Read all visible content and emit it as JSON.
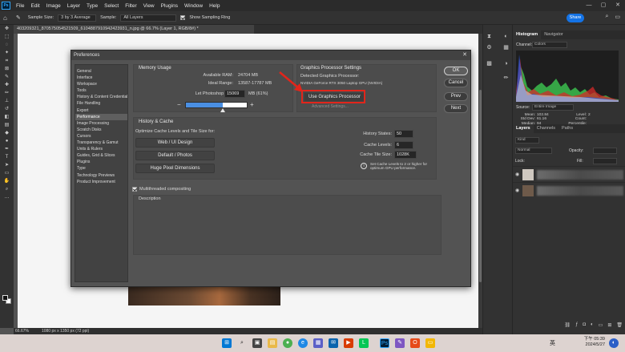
{
  "app": {
    "menu": [
      "File",
      "Edit",
      "Image",
      "Layer",
      "Type",
      "Select",
      "Filter",
      "View",
      "Plugins",
      "Window",
      "Help"
    ],
    "window_controls": [
      "—",
      "▢",
      "✕"
    ]
  },
  "options_bar": {
    "sample_size_label": "Sample Size:",
    "sample_size_value": "3 by 3 Average",
    "sample_label": "Sample:",
    "sample_value": "All Layers",
    "show_sampling_ring": "Show Sampling Ring",
    "share": "Share"
  },
  "document": {
    "tab_title": "403209321_870575054521509_6104887910942423931_n.jpg @ 66.7% (Layer 1, RGB/8#) *",
    "zoom": "66.67%",
    "dimensions": "1080 px x 1350 px (72 ppi)"
  },
  "preferences": {
    "title": "Preferences",
    "nav": [
      "General",
      "Interface",
      "Workspace",
      "Tools",
      "History & Content Credentials",
      "File Handling",
      "Export",
      "Performance",
      "Image Processing",
      "Scratch Disks",
      "Cursors",
      "Transparency & Gamut",
      "Units & Rulers",
      "Guides, Grid & Slices",
      "Plugins",
      "Type",
      "Technology Previews",
      "Product Improvement"
    ],
    "active_nav": "Performance",
    "memory": {
      "title": "Memory Usage",
      "available_label": "Available RAM:",
      "available_value": "24704 MB",
      "ideal_label": "Ideal Range:",
      "ideal_value": "13587-17787 MB",
      "let_use_label": "Let Photoshop Use:",
      "let_use_value": "15069",
      "let_use_suffix": "MB (61%)",
      "usage_fraction": 0.61,
      "minus": "−",
      "plus": "+"
    },
    "gpu": {
      "title": "Graphics Processor Settings",
      "detected_label": "Detected Graphics Processor:",
      "detected_value": "NVIDIA GeForce RTX 3050 Laptop GPU (NVIDIA)",
      "use_gpu": "Use Graphics Processor",
      "advanced": "Advanced Settings..."
    },
    "history_cache": {
      "title": "History & Cache",
      "optimize_label": "Optimize Cache Levels and Tile Size for:",
      "buttons": [
        "Web / UI Design",
        "Default / Photos",
        "Huge Pixel Dimensions"
      ],
      "history_states_label": "History States:",
      "history_states_value": "50",
      "cache_levels_label": "Cache Levels:",
      "cache_levels_value": "6",
      "tile_size_label": "Cache Tile Size:",
      "tile_size_value": "1028K",
      "info_text": "Set Cache Levels to 2 or higher for optimum GPU performance."
    },
    "multithreaded": "Multithreaded compositing",
    "description_title": "Description",
    "buttons": {
      "ok": "OK",
      "cancel": "Cancel",
      "prev": "Prev",
      "next": "Next"
    }
  },
  "histogram_panel": {
    "tabs": [
      "Histogram",
      "Navigator"
    ],
    "channel_label": "Channel:",
    "channel_value": "Colors",
    "source_label": "Source:",
    "source_value": "Entire Image",
    "stats_left_labels": [
      "Mean:",
      "Std Dev:",
      "Median:",
      "Pixels:"
    ],
    "stats_left_values": [
      "102.84",
      "61.16",
      "94",
      "364500"
    ],
    "stats_right_labels": [
      "Level:",
      "Count:",
      "Percentile:",
      "Cache Level:"
    ],
    "stats_right_values": [
      "",
      "",
      "",
      "2"
    ]
  },
  "layers_panel": {
    "tabs": [
      "Layers",
      "Channels",
      "Paths"
    ],
    "kind_label": "Kind",
    "blend_mode": "Normal",
    "opacity_label": "Opacity:",
    "lock_label": "Lock:",
    "fill_label": "Fill:"
  },
  "taskbar": {
    "icons": [
      "windows-start",
      "search",
      "task-view",
      "file-explorer",
      "chrome",
      "edge",
      "store",
      "mail",
      "media",
      "line",
      "photoshop",
      "paint",
      "office",
      "folder"
    ],
    "time": "下午 05:39",
    "date": "2024/5/27",
    "ime": "英"
  }
}
